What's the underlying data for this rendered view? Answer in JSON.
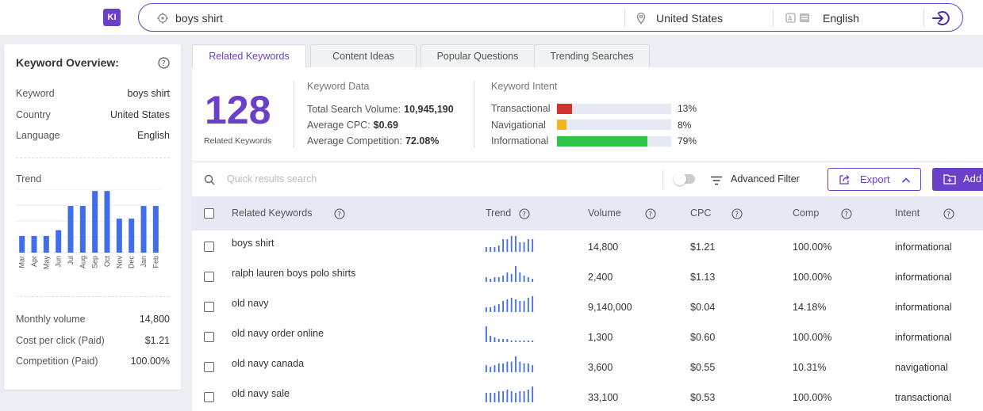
{
  "app": {
    "logo": "KI"
  },
  "search": {
    "query": "boys shirt",
    "country": "United States",
    "language": "English"
  },
  "overview": {
    "title": "Keyword Overview:",
    "rows": [
      {
        "label": "Keyword",
        "value": "boys shirt"
      },
      {
        "label": "Country",
        "value": "United States"
      },
      {
        "label": "Language",
        "value": "English"
      }
    ],
    "trend_label": "Trend",
    "stats": [
      {
        "label": "Monthly volume",
        "value": "14,800"
      },
      {
        "label": "Cost per click (Paid)",
        "value": "$1.21"
      },
      {
        "label": "Competition (Paid)",
        "value": "100.00%"
      }
    ]
  },
  "chart_data": {
    "type": "bar",
    "categories": [
      "Mar",
      "Apr",
      "May",
      "Jun",
      "Jul",
      "Aug",
      "Sep",
      "Oct",
      "Nov",
      "Dec",
      "Jan",
      "Feb"
    ],
    "values": [
      2.9,
      2.9,
      2.9,
      3.9,
      8.1,
      8.1,
      10.7,
      10.7,
      5.9,
      5.9,
      8.1,
      8.1
    ],
    "color": "#3f6ee8",
    "ylim": [
      0,
      11
    ]
  },
  "tabs": [
    {
      "label": "Related Keywords",
      "active": true
    },
    {
      "label": "Content Ideas",
      "active": false
    },
    {
      "label": "Popular Questions",
      "active": false
    },
    {
      "label": "Trending Searches",
      "active": false
    }
  ],
  "summary": {
    "count": "128",
    "count_label": "Related Keywords",
    "data_title": "Keyword Data",
    "total_volume_label": "Total Search Volume:",
    "total_volume": "10,945,190",
    "avg_cpc_label": "Average CPC:",
    "avg_cpc": "$0.69",
    "avg_comp_label": "Average Competition:",
    "avg_comp": "72.08%",
    "intent_title": "Keyword Intent",
    "intents": [
      {
        "label": "Transactional",
        "pct": "13%",
        "value": 0.13,
        "color": "#d0342c"
      },
      {
        "label": "Navigational",
        "pct": "8%",
        "value": 0.08,
        "color": "#f6b51e"
      },
      {
        "label": "Informational",
        "pct": "79%",
        "value": 0.79,
        "color": "#2ec34a"
      }
    ]
  },
  "toolbar": {
    "search_placeholder": "Quick results search",
    "advanced_filter": "Advanced Filter",
    "export": "Export",
    "add": "Add"
  },
  "table": {
    "headers": {
      "keyword": "Related Keywords",
      "trend": "Trend",
      "volume": "Volume",
      "cpc": "CPC",
      "comp": "Comp",
      "intent": "Intent"
    },
    "rows": [
      {
        "keyword": "boys shirt",
        "volume": "14,800",
        "cpc": "$1.21",
        "comp": "100.00%",
        "intent": "informational",
        "trend": [
          3,
          3,
          3,
          4,
          8,
          8,
          10,
          10,
          6,
          6,
          8,
          8
        ]
      },
      {
        "keyword": "ralph lauren boys polo shirts",
        "volume": "2,400",
        "cpc": "$1.13",
        "comp": "100.00%",
        "intent": "informational",
        "trend": [
          3,
          2,
          3,
          3,
          4,
          6,
          5,
          10,
          6,
          4,
          3,
          2
        ]
      },
      {
        "keyword": "old navy",
        "volume": "9,140,000",
        "cpc": "$0.04",
        "comp": "14.18%",
        "intent": "informational",
        "trend": [
          3,
          3,
          4,
          5,
          7,
          8,
          9,
          8,
          7,
          7,
          9,
          10
        ]
      },
      {
        "keyword": "old navy order online",
        "volume": "1,300",
        "cpc": "$0.60",
        "comp": "100.00%",
        "intent": "informational",
        "trend": [
          10,
          4,
          3,
          2,
          2,
          2,
          1,
          1,
          1,
          1,
          1,
          1
        ]
      },
      {
        "keyword": "old navy canada",
        "volume": "3,600",
        "cpc": "$0.55",
        "comp": "10.31%",
        "intent": "navigational",
        "trend": [
          4,
          3,
          4,
          5,
          5,
          6,
          6,
          9,
          6,
          5,
          5,
          4
        ]
      },
      {
        "keyword": "old navy sale",
        "volume": "33,100",
        "cpc": "$0.53",
        "comp": "100.00%",
        "intent": "transactional",
        "trend": [
          6,
          6,
          6,
          7,
          7,
          8,
          7,
          6,
          7,
          7,
          8,
          10
        ]
      }
    ]
  }
}
